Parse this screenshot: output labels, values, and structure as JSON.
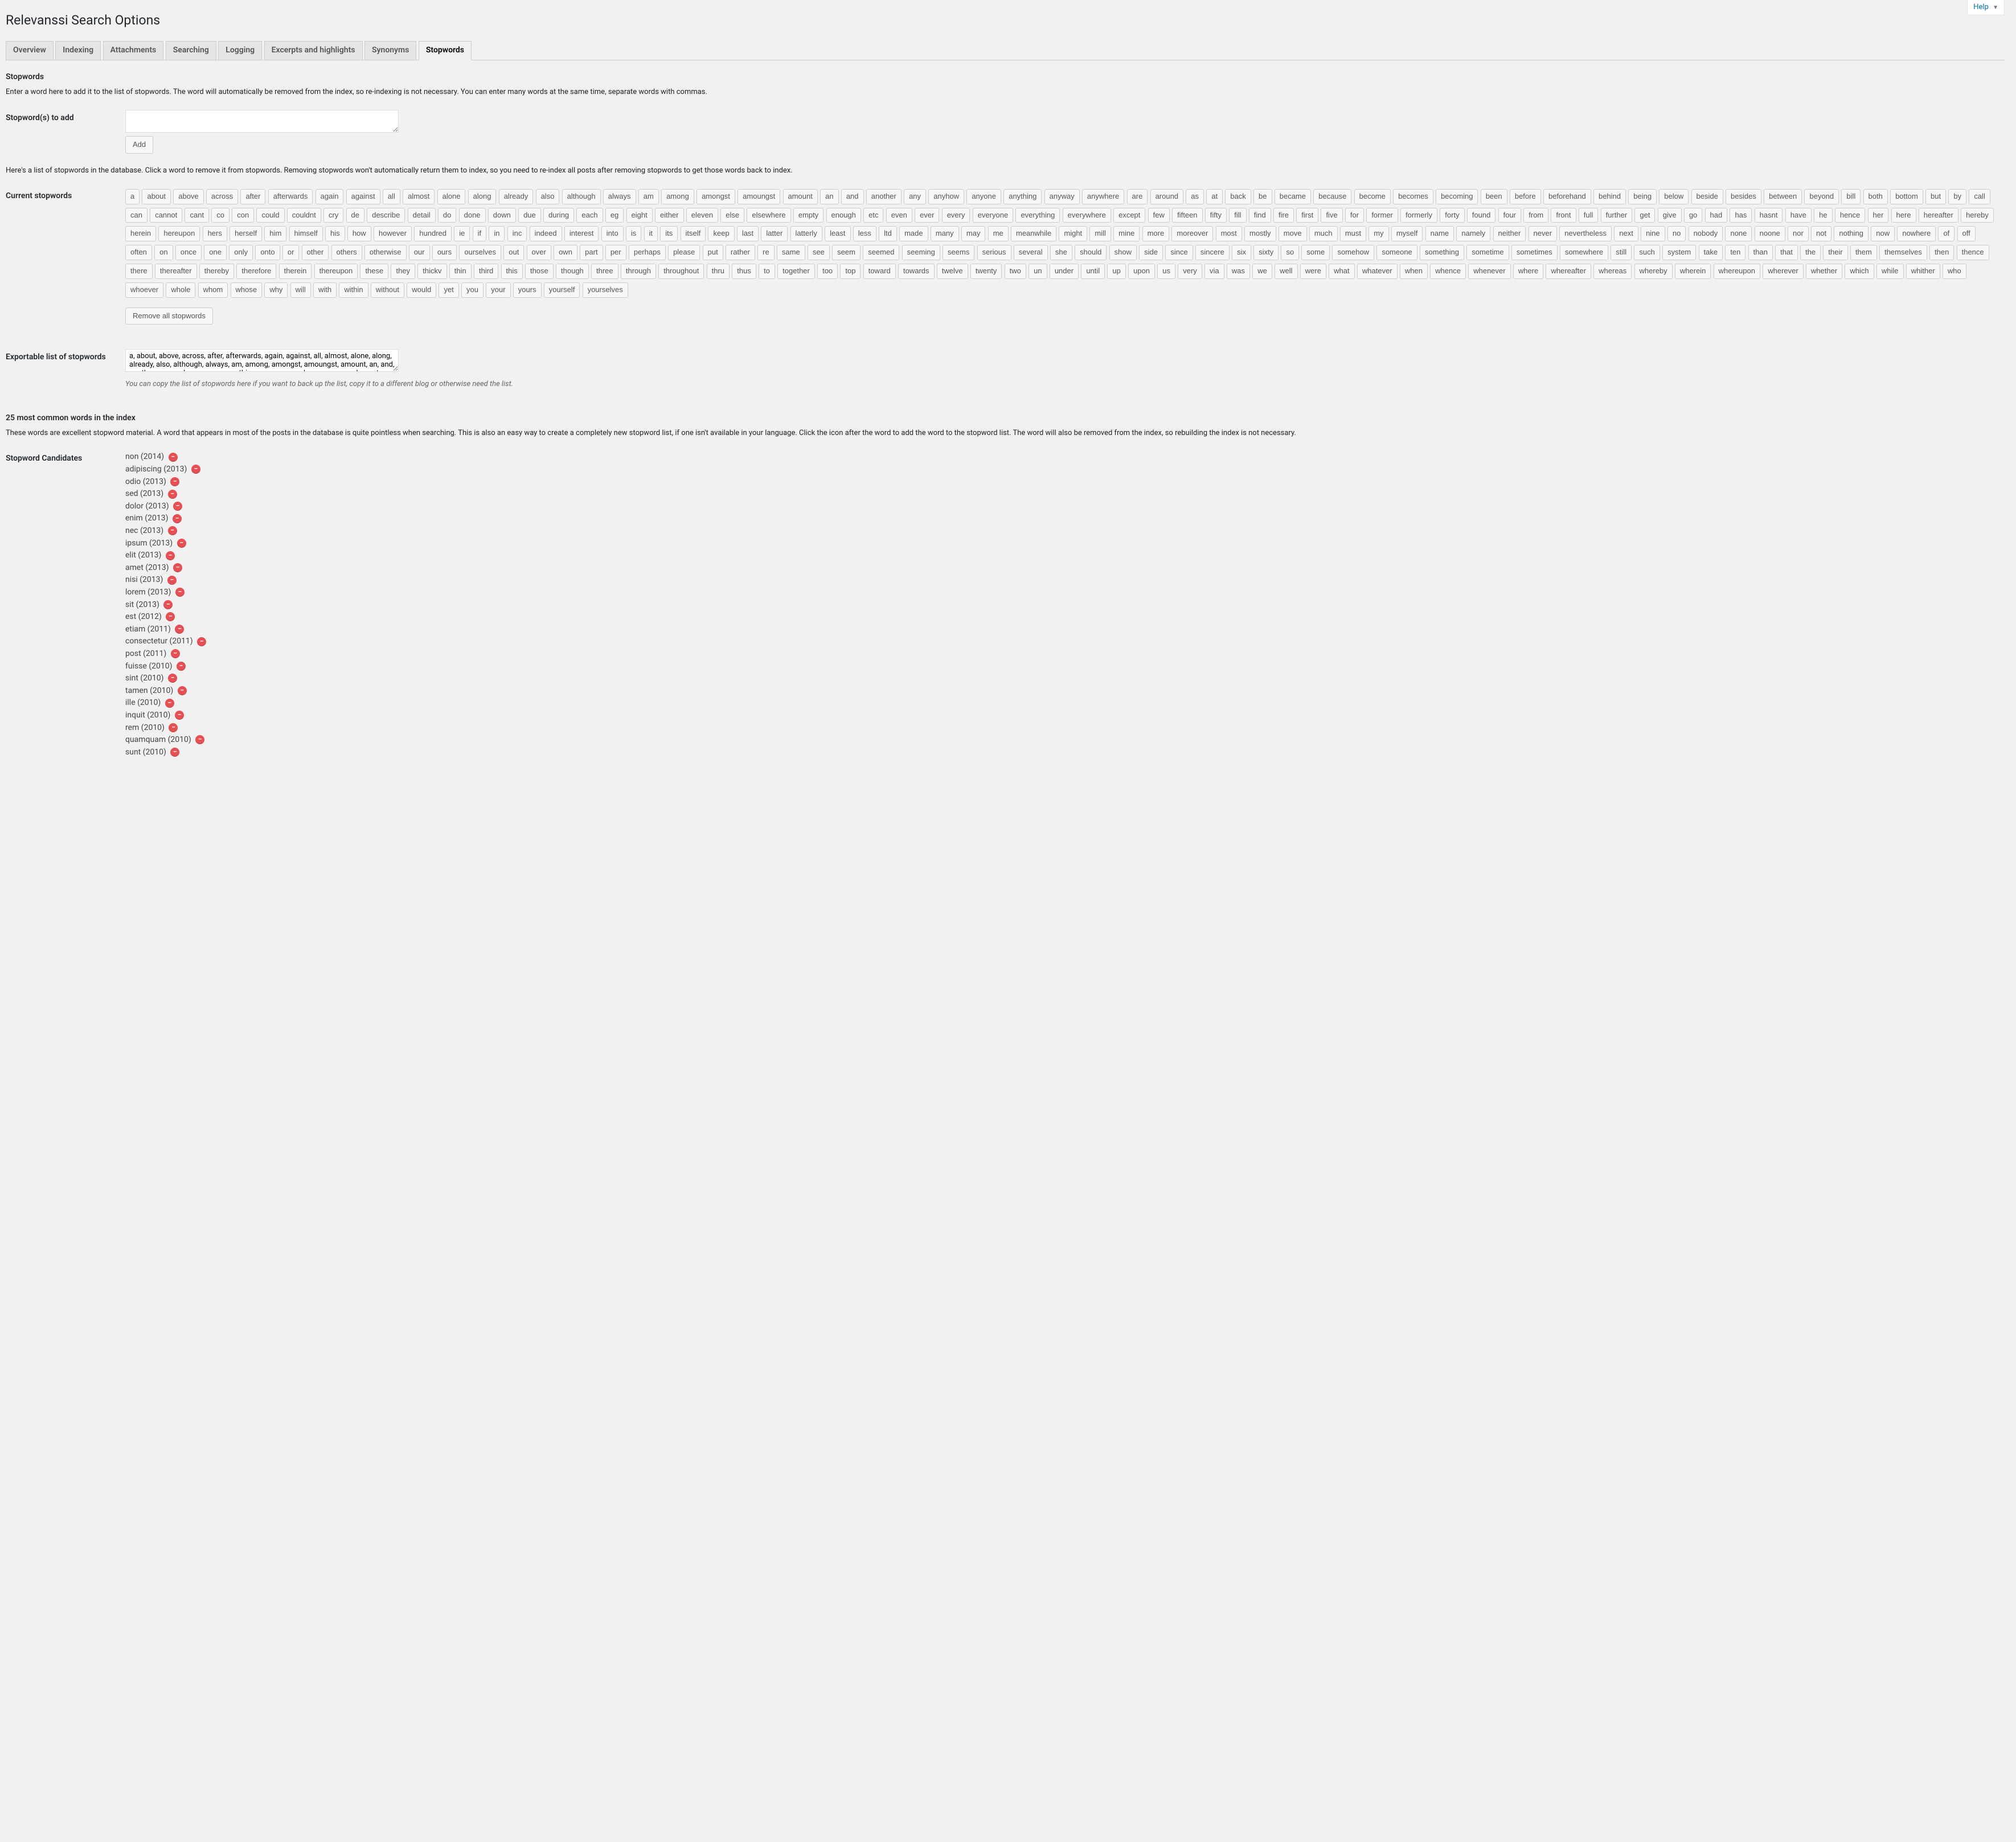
{
  "help": {
    "label": "Help"
  },
  "page": {
    "title": "Relevanssi Search Options"
  },
  "tabs": [
    {
      "label": "Overview",
      "active": false
    },
    {
      "label": "Indexing",
      "active": false
    },
    {
      "label": "Attachments",
      "active": false
    },
    {
      "label": "Searching",
      "active": false
    },
    {
      "label": "Logging",
      "active": false
    },
    {
      "label": "Excerpts and highlights",
      "active": false
    },
    {
      "label": "Synonyms",
      "active": false
    },
    {
      "label": "Stopwords",
      "active": true
    }
  ],
  "stopwords": {
    "heading": "Stopwords",
    "intro": "Enter a word here to add it to the list of stopwords. The word will automatically be removed from the index, so re-indexing is not necessary. You can enter many words at the same time, separate words with commas.",
    "add_label": "Stopword(s) to add",
    "add_button": "Add",
    "list_intro": "Here's a list of stopwords in the database. Click a word to remove it from stopwords. Removing stopwords won't automatically return them to index, so you need to re-index all posts after removing stopwords to get those words back to index.",
    "current_label": "Current stopwords",
    "remove_all_button": "Remove all stopwords",
    "export_label": "Exportable list of stopwords",
    "export_hint": "You can copy the list of stopwords here if you want to back up the list, copy it to a different blog or otherwise need the list.",
    "words": [
      "a",
      "about",
      "above",
      "across",
      "after",
      "afterwards",
      "again",
      "against",
      "all",
      "almost",
      "alone",
      "along",
      "already",
      "also",
      "although",
      "always",
      "am",
      "among",
      "amongst",
      "amoungst",
      "amount",
      "an",
      "and",
      "another",
      "any",
      "anyhow",
      "anyone",
      "anything",
      "anyway",
      "anywhere",
      "are",
      "around",
      "as",
      "at",
      "back",
      "be",
      "became",
      "because",
      "become",
      "becomes",
      "becoming",
      "been",
      "before",
      "beforehand",
      "behind",
      "being",
      "below",
      "beside",
      "besides",
      "between",
      "beyond",
      "bill",
      "both",
      "bottom",
      "but",
      "by",
      "call",
      "can",
      "cannot",
      "cant",
      "co",
      "con",
      "could",
      "couldnt",
      "cry",
      "de",
      "describe",
      "detail",
      "do",
      "done",
      "down",
      "due",
      "during",
      "each",
      "eg",
      "eight",
      "either",
      "eleven",
      "else",
      "elsewhere",
      "empty",
      "enough",
      "etc",
      "even",
      "ever",
      "every",
      "everyone",
      "everything",
      "everywhere",
      "except",
      "few",
      "fifteen",
      "fifty",
      "fill",
      "find",
      "fire",
      "first",
      "five",
      "for",
      "former",
      "formerly",
      "forty",
      "found",
      "four",
      "from",
      "front",
      "full",
      "further",
      "get",
      "give",
      "go",
      "had",
      "has",
      "hasnt",
      "have",
      "he",
      "hence",
      "her",
      "here",
      "hereafter",
      "hereby",
      "herein",
      "hereupon",
      "hers",
      "herself",
      "him",
      "himself",
      "his",
      "how",
      "however",
      "hundred",
      "ie",
      "if",
      "in",
      "inc",
      "indeed",
      "interest",
      "into",
      "is",
      "it",
      "its",
      "itself",
      "keep",
      "last",
      "latter",
      "latterly",
      "least",
      "less",
      "ltd",
      "made",
      "many",
      "may",
      "me",
      "meanwhile",
      "might",
      "mill",
      "mine",
      "more",
      "moreover",
      "most",
      "mostly",
      "move",
      "much",
      "must",
      "my",
      "myself",
      "name",
      "namely",
      "neither",
      "never",
      "nevertheless",
      "next",
      "nine",
      "no",
      "nobody",
      "none",
      "noone",
      "nor",
      "not",
      "nothing",
      "now",
      "nowhere",
      "of",
      "off",
      "often",
      "on",
      "once",
      "one",
      "only",
      "onto",
      "or",
      "other",
      "others",
      "otherwise",
      "our",
      "ours",
      "ourselves",
      "out",
      "over",
      "own",
      "part",
      "per",
      "perhaps",
      "please",
      "put",
      "rather",
      "re",
      "same",
      "see",
      "seem",
      "seemed",
      "seeming",
      "seems",
      "serious",
      "several",
      "she",
      "should",
      "show",
      "side",
      "since",
      "sincere",
      "six",
      "sixty",
      "so",
      "some",
      "somehow",
      "someone",
      "something",
      "sometime",
      "sometimes",
      "somewhere",
      "still",
      "such",
      "system",
      "take",
      "ten",
      "than",
      "that",
      "the",
      "their",
      "them",
      "themselves",
      "then",
      "thence",
      "there",
      "thereafter",
      "thereby",
      "therefore",
      "therein",
      "thereupon",
      "these",
      "they",
      "thickv",
      "thin",
      "third",
      "this",
      "those",
      "though",
      "three",
      "through",
      "throughout",
      "thru",
      "thus",
      "to",
      "together",
      "too",
      "top",
      "toward",
      "towards",
      "twelve",
      "twenty",
      "two",
      "un",
      "under",
      "until",
      "up",
      "upon",
      "us",
      "very",
      "via",
      "was",
      "we",
      "well",
      "were",
      "what",
      "whatever",
      "when",
      "whence",
      "whenever",
      "where",
      "whereafter",
      "whereas",
      "whereby",
      "wherein",
      "whereupon",
      "wherever",
      "whether",
      "which",
      "while",
      "whither",
      "who",
      "whoever",
      "whole",
      "whom",
      "whose",
      "why",
      "will",
      "with",
      "within",
      "without",
      "would",
      "yet",
      "you",
      "your",
      "yours",
      "yourself",
      "yourselves"
    ]
  },
  "common": {
    "heading": "25 most common words in the index",
    "intro": "These words are excellent stopword material. A word that appears in most of the posts in the database is quite pointless when searching. This is also an easy way to create a completely new stopword list, if one isn't available in your language. Click the icon after the word to add the word to the stopword list. The word will also be removed from the index, so rebuilding the index is not necessary.",
    "candidates_label": "Stopword Candidates",
    "candidates": [
      {
        "word": "non",
        "count": 2014
      },
      {
        "word": "adipiscing",
        "count": 2013
      },
      {
        "word": "odio",
        "count": 2013
      },
      {
        "word": "sed",
        "count": 2013
      },
      {
        "word": "dolor",
        "count": 2013
      },
      {
        "word": "enim",
        "count": 2013
      },
      {
        "word": "nec",
        "count": 2013
      },
      {
        "word": "ipsum",
        "count": 2013
      },
      {
        "word": "elit",
        "count": 2013
      },
      {
        "word": "amet",
        "count": 2013
      },
      {
        "word": "nisi",
        "count": 2013
      },
      {
        "word": "lorem",
        "count": 2013
      },
      {
        "word": "sit",
        "count": 2013
      },
      {
        "word": "est",
        "count": 2012
      },
      {
        "word": "etiam",
        "count": 2011
      },
      {
        "word": "consectetur",
        "count": 2011
      },
      {
        "word": "post",
        "count": 2011
      },
      {
        "word": "fuisse",
        "count": 2010
      },
      {
        "word": "sint",
        "count": 2010
      },
      {
        "word": "tamen",
        "count": 2010
      },
      {
        "word": "ille",
        "count": 2010
      },
      {
        "word": "inquit",
        "count": 2010
      },
      {
        "word": "rem",
        "count": 2010
      },
      {
        "word": "quamquam",
        "count": 2010
      },
      {
        "word": "sunt",
        "count": 2010
      }
    ]
  }
}
